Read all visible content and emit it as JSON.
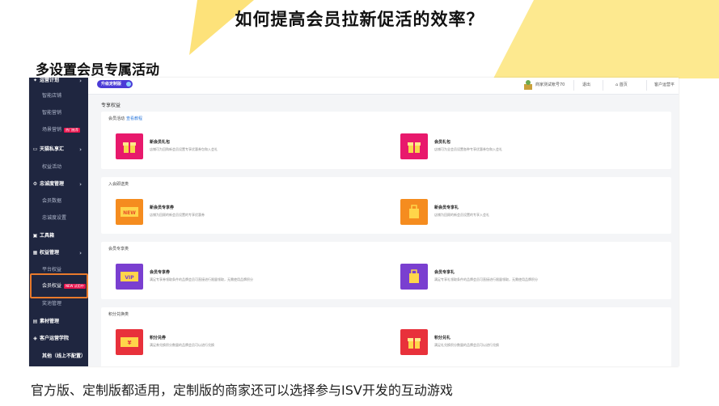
{
  "slide": {
    "title": "如何提高会员拉新促活的效率？",
    "subtitle": "多设置会员专属活动",
    "caption": "官方版、定制版都适用，定制版的商家还可以选择参与ISV开发的互动游戏",
    "accent_colors": [
      "#fde27a",
      "#f7c936"
    ]
  },
  "sidebar": {
    "items": [
      {
        "label": "运营计划",
        "icon": "bulb-icon",
        "level": "top",
        "chevron": true
      },
      {
        "label": "智能店铺",
        "level": "sub"
      },
      {
        "label": "智能营销",
        "level": "sub"
      },
      {
        "label": "场景营销",
        "level": "sub",
        "badge": "热门推荐"
      },
      {
        "label": "天猫私享汇",
        "icon": "tag-icon",
        "level": "top",
        "chevron": true
      },
      {
        "label": "权益活动",
        "level": "sub"
      },
      {
        "label": "忠诚度管理",
        "icon": "gear-icon",
        "level": "top",
        "chevron": true
      },
      {
        "label": "会员数据",
        "level": "sub"
      },
      {
        "label": "忠诚度设置",
        "level": "sub"
      },
      {
        "label": "工具箱",
        "icon": "toolbox-icon",
        "level": "top"
      },
      {
        "label": "权益管理",
        "icon": "gift-icon",
        "level": "top",
        "chevron": true
      },
      {
        "label": "平台权益",
        "level": "sub"
      },
      {
        "label": "会员权益",
        "level": "sub",
        "badge": "NEW 试用中",
        "active": true
      },
      {
        "label": "奖池管理",
        "level": "sub"
      },
      {
        "label": "素材管理",
        "icon": "image-icon",
        "level": "top"
      },
      {
        "label": "客户运营学院",
        "icon": "book-icon",
        "level": "top"
      },
      {
        "label": "其他（线上不配置）",
        "level": "top"
      }
    ]
  },
  "topbar": {
    "chip_label": "升级定制版",
    "account": "商家测试帐号70",
    "logout": "退出",
    "home": "首页",
    "platform": "客户运营平"
  },
  "content": {
    "page_heading": "专享权益",
    "sections": [
      {
        "title": "会员活动",
        "link": "查看教程",
        "entries": [
          {
            "name": "新会员礼包",
            "desc": "店铺可为回购新会员设置专享优惠券包和入会礼",
            "icon": "gift-box-icon",
            "color": "#e8196c"
          },
          {
            "name": "会员礼包",
            "desc": "店铺可为全会员设置各种专享优惠券包和入会礼",
            "icon": "gift-box-icon",
            "color": "#e8196c"
          }
        ]
      },
      {
        "title": "入会即送类",
        "entries": [
          {
            "name": "新会员专享券",
            "desc": "店铺为回顾的新会员设置的专享优惠券",
            "icon": "new-ticket-icon",
            "color": "#f58c1f"
          },
          {
            "name": "新会员专享礼",
            "desc": "店铺为回顾的新会员设置的专享入会礼",
            "icon": "gift-bag-icon",
            "color": "#f58c1f"
          }
        ]
      },
      {
        "title": "会员专享类",
        "entries": [
          {
            "name": "会员专享券",
            "desc": "满足专享券领取条件的品牌会员可直接进行限量领取，无需使用品牌积分",
            "icon": "vip-ticket-icon",
            "color": "#7a3fd0"
          },
          {
            "name": "会员专享礼",
            "desc": "满足专享礼领取条件的品牌会员可直接进行限量领取，无需使用品牌积分",
            "icon": "gift-bag-icon",
            "color": "#7a3fd0"
          }
        ]
      },
      {
        "title": "积分兑换类",
        "entries": [
          {
            "name": "积分兑券",
            "desc": "满足券兑换积分数量的品牌会员可以进行兑换",
            "icon": "yen-ticket-icon",
            "color": "#e8313b"
          },
          {
            "name": "积分兑礼",
            "desc": "满足礼兑换积分数量的品牌会员可以进行兑换",
            "icon": "gift-box-icon",
            "color": "#e8313b"
          }
        ]
      }
    ]
  }
}
